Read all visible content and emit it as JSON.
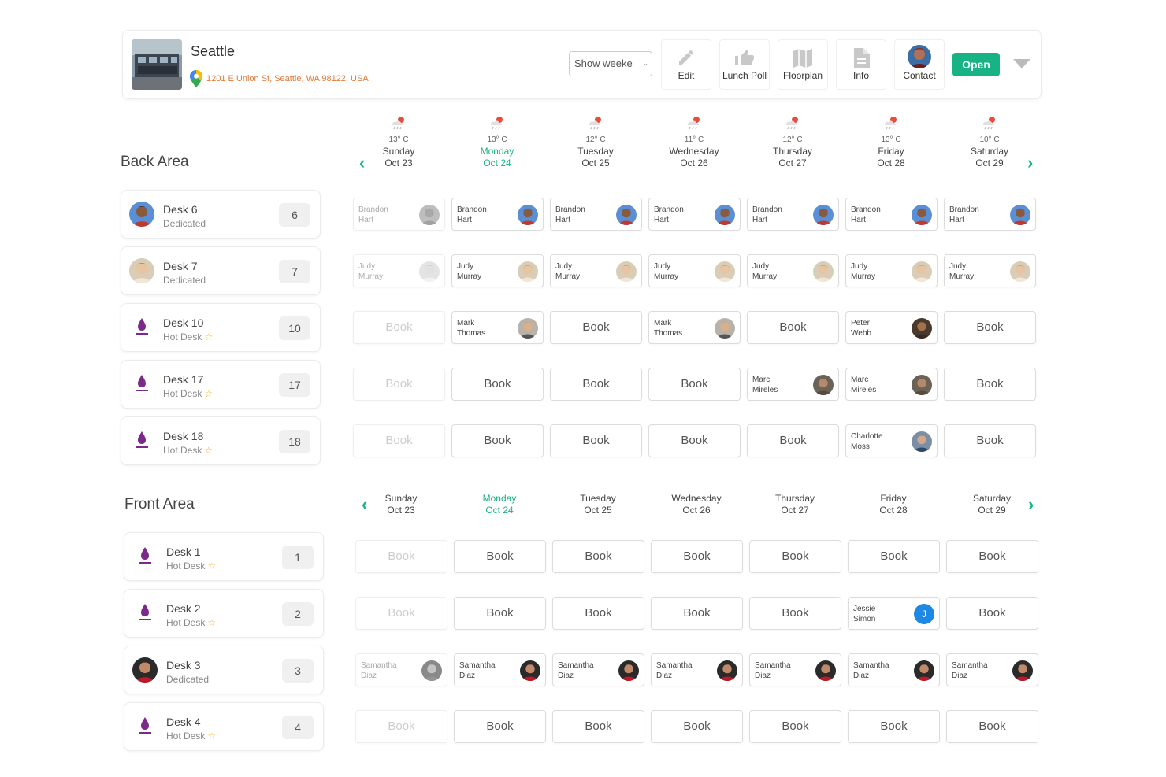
{
  "header": {
    "location_name": "Seattle",
    "address": "1201 E Union St, Seattle, WA 98122, USA",
    "week_select_value": "Show weeke",
    "buttons": [
      {
        "label": "Edit",
        "icon": "pencil-icon"
      },
      {
        "label": "Lunch Poll",
        "icon": "thumbs-up-icon"
      },
      {
        "label": "Floorplan",
        "icon": "map-icon"
      },
      {
        "label": "Info",
        "icon": "document-icon"
      },
      {
        "label": "Contact",
        "icon": "contact-avatar"
      }
    ],
    "open_label": "Open",
    "colors": {
      "accent": "#17b384",
      "address": "#e07b39"
    }
  },
  "days": [
    {
      "name": "Sunday",
      "date": "Oct 23",
      "temp": "13° C"
    },
    {
      "name": "Monday",
      "date": "Oct 24",
      "temp": "13° C",
      "today": true
    },
    {
      "name": "Tuesday",
      "date": "Oct 25",
      "temp": "12° C"
    },
    {
      "name": "Wednesday",
      "date": "Oct 26",
      "temp": "11° C"
    },
    {
      "name": "Thursday",
      "date": "Oct 27",
      "temp": "12° C"
    },
    {
      "name": "Friday",
      "date": "Oct 28",
      "temp": "13° C"
    },
    {
      "name": "Saturday",
      "date": "Oct 29",
      "temp": "10° C"
    }
  ],
  "book_label": "Book",
  "star": "☆",
  "areas": [
    {
      "title": "Back Area",
      "desks": [
        {
          "name": "Desk 6",
          "type": "Dedicated",
          "number": "6",
          "avatar": "brandon",
          "cells": [
            "Brandon\nHart",
            "Brandon\nHart",
            "Brandon\nHart",
            "Brandon\nHart",
            "Brandon\nHart",
            "Brandon\nHart",
            "Brandon\nHart"
          ],
          "cell_avatars": [
            "brandon",
            "brandon",
            "brandon",
            "brandon",
            "brandon",
            "brandon",
            "brandon"
          ]
        },
        {
          "name": "Desk 7",
          "type": "Dedicated",
          "number": "7",
          "avatar": "judy",
          "cells": [
            "Judy\nMurray",
            "Judy\nMurray",
            "Judy\nMurray",
            "Judy\nMurray",
            "Judy\nMurray",
            "Judy\nMurray",
            "Judy\nMurray"
          ],
          "cell_avatars": [
            "judy",
            "judy",
            "judy",
            "judy",
            "judy",
            "judy",
            "judy"
          ]
        },
        {
          "name": "Desk 10",
          "type": "Hot Desk",
          "number": "10",
          "avatar": "desk",
          "cells": [
            "",
            "Mark\nThomas",
            "",
            "Mark\nThomas",
            "",
            "Peter\nWebb",
            ""
          ],
          "cell_avatars": [
            "",
            "mark",
            "",
            "mark",
            "",
            "peter",
            ""
          ]
        },
        {
          "name": "Desk 17",
          "type": "Hot Desk",
          "number": "17",
          "avatar": "desk",
          "cells": [
            "",
            "",
            "",
            "",
            "Marc\nMireles",
            "Marc\nMireles",
            ""
          ],
          "cell_avatars": [
            "",
            "",
            "",
            "",
            "marc",
            "marc",
            ""
          ]
        },
        {
          "name": "Desk 18",
          "type": "Hot Desk",
          "number": "18",
          "avatar": "desk",
          "cells": [
            "",
            "",
            "",
            "",
            "",
            "Charlotte\nMoss",
            ""
          ],
          "cell_avatars": [
            "",
            "",
            "",
            "",
            "",
            "charlotte",
            ""
          ]
        }
      ]
    },
    {
      "title": "Front Area",
      "desks": [
        {
          "name": "Desk 1",
          "type": "Hot Desk",
          "number": "1",
          "avatar": "desk",
          "cells": [
            "",
            "",
            "",
            "",
            "",
            "",
            ""
          ],
          "cell_avatars": [
            "",
            "",
            "",
            "",
            "",
            "",
            ""
          ]
        },
        {
          "name": "Desk 2",
          "type": "Hot Desk",
          "number": "2",
          "avatar": "desk",
          "cells": [
            "",
            "",
            "",
            "",
            "",
            "Jessie\nSimon",
            ""
          ],
          "cell_avatars": [
            "",
            "",
            "",
            "",
            "",
            "J",
            ""
          ]
        },
        {
          "name": "Desk 3",
          "type": "Dedicated",
          "number": "3",
          "avatar": "samantha",
          "cells": [
            "Samantha\nDiaz",
            "Samantha\nDiaz",
            "Samantha\nDiaz",
            "Samantha\nDiaz",
            "Samantha\nDiaz",
            "Samantha\nDiaz",
            "Samantha\nDiaz"
          ],
          "cell_avatars": [
            "samantha",
            "samantha",
            "samantha",
            "samantha",
            "samantha",
            "samantha",
            "samantha"
          ]
        },
        {
          "name": "Desk 4",
          "type": "Hot Desk",
          "number": "4",
          "avatar": "desk",
          "cells": [
            "",
            "",
            "",
            "",
            "",
            "",
            ""
          ],
          "cell_avatars": [
            "",
            "",
            "",
            "",
            "",
            "",
            ""
          ]
        }
      ]
    }
  ]
}
